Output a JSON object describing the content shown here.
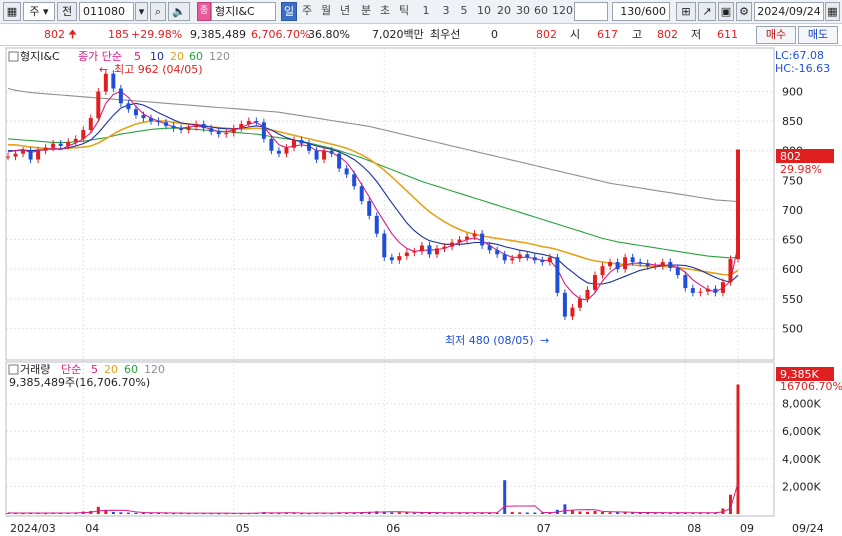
{
  "toolbar": {
    "menu_label": "주",
    "prefix_label": "전",
    "code": "011080",
    "stock_name": "형지I&C",
    "periods": [
      "일",
      "주",
      "월",
      "년",
      "분",
      "초",
      "틱"
    ],
    "intervals": [
      "1",
      "3",
      "5",
      "10",
      "20",
      "30",
      "60",
      "120"
    ],
    "count": "130/600",
    "date": "2024/09/24"
  },
  "quote": {
    "price": "802",
    "change": "185",
    "change_pct": "+29.98%",
    "volume": "9,385,489",
    "volume_ratio": "6,706.70%",
    "turnover": "36.80%",
    "amount": "7,020백만",
    "pref_label": "최우선",
    "pref_value": "0",
    "ask": "802",
    "open_label": "시",
    "open": "617",
    "high_label": "고",
    "high": "802",
    "low_label": "저",
    "low": "611",
    "buy_label": "매수",
    "sell_label": "매도"
  },
  "price_panel": {
    "title": "형지I&C",
    "ma_label": "종가 단순",
    "ma_periods": [
      "5",
      "10",
      "20",
      "60",
      "120"
    ],
    "ma_colors": [
      "#d81b8c",
      "#1c2e9c",
      "#e5a21a",
      "#29a33d",
      "#8f8f8f"
    ],
    "high_marker": "최고 962 (04/05)",
    "low_marker": "최저 480 (08/05)",
    "lc": "LC:67.08",
    "hc": "HC:-16.63",
    "current_price": "802",
    "current_pct": "29.98%",
    "y_ticks": [
      "900",
      "850",
      "800",
      "750",
      "700",
      "650",
      "600",
      "550",
      "500"
    ]
  },
  "volume_panel": {
    "title": "거래량",
    "ma_label": "단순",
    "ma_periods": [
      "5",
      "20",
      "60",
      "120"
    ],
    "summary": "9,385,489주(16,706.70%)",
    "current": "9,385K",
    "current_pct": "16706.70%",
    "y_ticks": [
      "8,000K",
      "6,000K",
      "4,000K",
      "2,000K"
    ]
  },
  "x_axis": {
    "labels": [
      "2024/03",
      "04",
      "05",
      "06",
      "07",
      "08",
      "09",
      "09/24"
    ]
  },
  "chart_data": {
    "type": "line",
    "series": [
      {
        "name": "종가",
        "values": [
          790,
          795,
          800,
          785,
          800,
          805,
          812,
          808,
          815,
          820,
          835,
          855,
          900,
          930,
          905,
          880,
          870,
          860,
          855,
          850,
          848,
          842,
          838,
          835,
          840,
          845,
          838,
          832,
          828,
          830,
          838,
          845,
          850,
          848,
          820,
          800,
          795,
          805,
          818,
          812,
          800,
          785,
          800,
          795,
          770,
          760,
          740,
          715,
          690,
          660,
          620,
          615,
          622,
          628,
          630,
          640,
          625,
          635,
          638,
          645,
          650,
          655,
          660,
          640,
          632,
          625,
          615,
          618,
          625,
          620,
          615,
          612,
          620,
          560,
          520,
          535,
          550,
          565,
          590,
          605,
          612,
          600,
          620,
          612,
          610,
          605,
          605,
          612,
          602,
          590,
          568,
          560,
          562,
          567,
          560,
          578,
          617,
          802
        ]
      },
      {
        "name": "5",
        "values": [
          798,
          800,
          802,
          797,
          800,
          802,
          804,
          802,
          808,
          813,
          820,
          830,
          850,
          880,
          895,
          900,
          890,
          875,
          862,
          855,
          850,
          845,
          840,
          838,
          840,
          842,
          840,
          836,
          832,
          832,
          835,
          839,
          845,
          848,
          840,
          825,
          810,
          805,
          808,
          810,
          808,
          800,
          800,
          797,
          790,
          780,
          763,
          743,
          722,
          700,
          680,
          660,
          645,
          635,
          630,
          632,
          632,
          633,
          635,
          640,
          645,
          650,
          653,
          648,
          640,
          632,
          625,
          620,
          620,
          620,
          618,
          615,
          615,
          600,
          575,
          560,
          550,
          548,
          560,
          580,
          595,
          604,
          607,
          610,
          610,
          609,
          607,
          607,
          606,
          603,
          595,
          582,
          573,
          565,
          562,
          568,
          580,
          640
        ]
      },
      {
        "name": "10",
        "values": [
          800,
          800,
          801,
          800,
          801,
          802,
          803,
          803,
          805,
          808,
          812,
          818,
          830,
          845,
          860,
          872,
          877,
          880,
          877,
          871,
          864,
          858,
          852,
          847,
          845,
          844,
          842,
          840,
          838,
          837,
          837,
          838,
          840,
          842,
          840,
          835,
          828,
          822,
          818,
          815,
          812,
          808,
          805,
          802,
          798,
          792,
          785,
          775,
          763,
          748,
          730,
          712,
          695,
          678,
          665,
          655,
          648,
          645,
          642,
          642,
          642,
          643,
          645,
          645,
          644,
          642,
          638,
          635,
          632,
          630,
          627,
          625,
          622,
          617,
          605,
          595,
          585,
          577,
          575,
          575,
          578,
          583,
          588,
          593,
          598,
          601,
          604,
          606,
          607,
          607,
          606,
          603,
          598,
          592,
          586,
          581,
          578,
          590
        ]
      },
      {
        "name": "20",
        "values": [
          810,
          810,
          808,
          806,
          805,
          804,
          803,
          803,
          804,
          805,
          806,
          808,
          813,
          820,
          828,
          835,
          840,
          845,
          848,
          850,
          850,
          850,
          848,
          846,
          845,
          843,
          842,
          840,
          839,
          838,
          837,
          837,
          837,
          838,
          837,
          835,
          832,
          829,
          826,
          823,
          820,
          817,
          814,
          811,
          808,
          804,
          799,
          793,
          786,
          777,
          767,
          756,
          744,
          732,
          720,
          708,
          697,
          688,
          680,
          673,
          667,
          662,
          659,
          656,
          654,
          652,
          650,
          648,
          646,
          644,
          641,
          638,
          636,
          633,
          629,
          625,
          621,
          617,
          614,
          612,
          610,
          609,
          608,
          607,
          606,
          605,
          605,
          605,
          604,
          603,
          601,
          599,
          597,
          595,
          593,
          591,
          590,
          598
        ]
      },
      {
        "name": "60",
        "values": [
          820,
          819,
          818,
          817,
          816,
          815,
          814,
          814,
          814,
          815,
          816,
          818,
          820,
          822,
          825,
          828,
          830,
          832,
          834,
          836,
          837,
          838,
          838,
          838,
          837,
          836,
          835,
          834,
          833,
          832,
          831,
          830,
          829,
          828,
          826,
          824,
          822,
          820,
          818,
          816,
          813,
          810,
          807,
          804,
          800,
          796,
          792,
          788,
          783,
          778,
          773,
          768,
          763,
          758,
          753,
          748,
          744,
          740,
          736,
          732,
          728,
          724,
          720,
          716,
          712,
          708,
          704,
          700,
          696,
          692,
          688,
          684,
          680,
          676,
          672,
          668,
          664,
          660,
          656,
          652,
          649,
          646,
          644,
          642,
          640,
          638,
          636,
          634,
          632,
          630,
          628,
          626,
          624,
          622,
          621,
          620,
          619,
          620
        ]
      },
      {
        "name": "120",
        "values": [
          905,
          902,
          900,
          898,
          897,
          896,
          895,
          894,
          893,
          892,
          891,
          890,
          889,
          888,
          887,
          886,
          885,
          884,
          883,
          882,
          881,
          880,
          879,
          878,
          877,
          876,
          875,
          874,
          873,
          872,
          871,
          870,
          869,
          868,
          867,
          866,
          865,
          863,
          861,
          859,
          857,
          855,
          853,
          851,
          849,
          847,
          845,
          843,
          841,
          838,
          835,
          832,
          829,
          826,
          823,
          820,
          817,
          814,
          811,
          808,
          805,
          802,
          799,
          796,
          793,
          790,
          787,
          784,
          781,
          778,
          775,
          772,
          769,
          766,
          763,
          760,
          757,
          754,
          751,
          748,
          745,
          743,
          741,
          739,
          737,
          735,
          733,
          731,
          729,
          727,
          725,
          723,
          721,
          719,
          717,
          716,
          715,
          714
        ]
      },
      {
        "name": "거래량",
        "values": [
          80,
          70,
          60,
          90,
          75,
          60,
          70,
          80,
          90,
          100,
          180,
          220,
          520,
          300,
          150,
          120,
          100,
          90,
          80,
          75,
          80,
          70,
          60,
          65,
          60,
          70,
          65,
          60,
          55,
          60,
          65,
          60,
          62,
          70,
          140,
          80,
          60,
          70,
          80,
          60,
          60,
          80,
          70,
          60,
          120,
          90,
          110,
          130,
          150,
          200,
          180,
          120,
          130,
          110,
          90,
          100,
          110,
          80,
          90,
          85,
          90,
          95,
          80,
          90,
          85,
          80,
          2450,
          150,
          120,
          110,
          100,
          90,
          80,
          300,
          700,
          250,
          180,
          160,
          220,
          140,
          120,
          130,
          110,
          100,
          90,
          120,
          100,
          90,
          80,
          100,
          110,
          90,
          80,
          85,
          90,
          400,
          1400,
          9385
        ]
      }
    ],
    "ylim": [
      450,
      970
    ],
    "volume_ylim": [
      0,
      10000
    ],
    "high": {
      "value": 962,
      "date": "04/05"
    },
    "low": {
      "value": 480,
      "date": "08/05"
    }
  }
}
